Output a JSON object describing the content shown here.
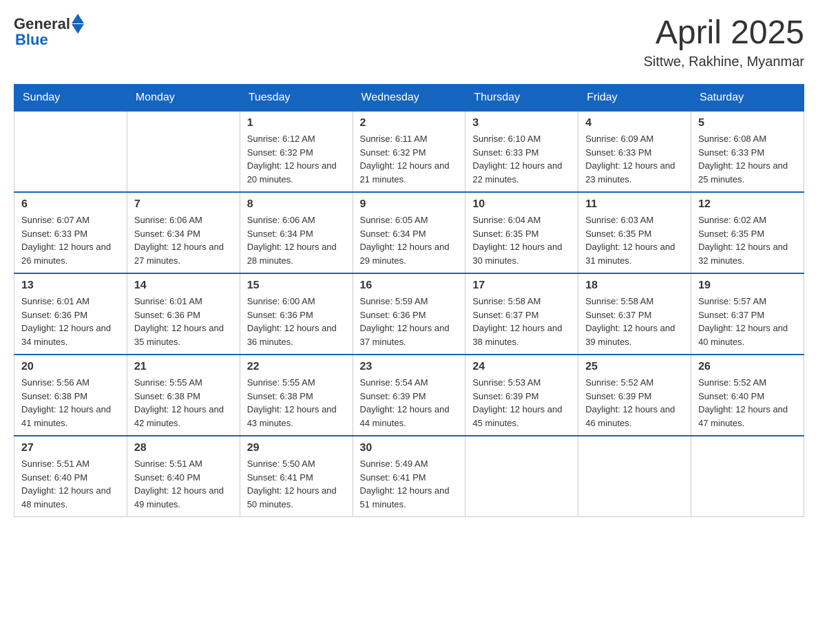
{
  "header": {
    "logo_general": "General",
    "logo_blue": "Blue",
    "month_year": "April 2025",
    "location": "Sittwe, Rakhine, Myanmar"
  },
  "days_of_week": [
    "Sunday",
    "Monday",
    "Tuesday",
    "Wednesday",
    "Thursday",
    "Friday",
    "Saturday"
  ],
  "weeks": [
    [
      {
        "day": "",
        "sunrise": "",
        "sunset": "",
        "daylight": ""
      },
      {
        "day": "",
        "sunrise": "",
        "sunset": "",
        "daylight": ""
      },
      {
        "day": "1",
        "sunrise": "Sunrise: 6:12 AM",
        "sunset": "Sunset: 6:32 PM",
        "daylight": "Daylight: 12 hours and 20 minutes."
      },
      {
        "day": "2",
        "sunrise": "Sunrise: 6:11 AM",
        "sunset": "Sunset: 6:32 PM",
        "daylight": "Daylight: 12 hours and 21 minutes."
      },
      {
        "day": "3",
        "sunrise": "Sunrise: 6:10 AM",
        "sunset": "Sunset: 6:33 PM",
        "daylight": "Daylight: 12 hours and 22 minutes."
      },
      {
        "day": "4",
        "sunrise": "Sunrise: 6:09 AM",
        "sunset": "Sunset: 6:33 PM",
        "daylight": "Daylight: 12 hours and 23 minutes."
      },
      {
        "day": "5",
        "sunrise": "Sunrise: 6:08 AM",
        "sunset": "Sunset: 6:33 PM",
        "daylight": "Daylight: 12 hours and 25 minutes."
      }
    ],
    [
      {
        "day": "6",
        "sunrise": "Sunrise: 6:07 AM",
        "sunset": "Sunset: 6:33 PM",
        "daylight": "Daylight: 12 hours and 26 minutes."
      },
      {
        "day": "7",
        "sunrise": "Sunrise: 6:06 AM",
        "sunset": "Sunset: 6:34 PM",
        "daylight": "Daylight: 12 hours and 27 minutes."
      },
      {
        "day": "8",
        "sunrise": "Sunrise: 6:06 AM",
        "sunset": "Sunset: 6:34 PM",
        "daylight": "Daylight: 12 hours and 28 minutes."
      },
      {
        "day": "9",
        "sunrise": "Sunrise: 6:05 AM",
        "sunset": "Sunset: 6:34 PM",
        "daylight": "Daylight: 12 hours and 29 minutes."
      },
      {
        "day": "10",
        "sunrise": "Sunrise: 6:04 AM",
        "sunset": "Sunset: 6:35 PM",
        "daylight": "Daylight: 12 hours and 30 minutes."
      },
      {
        "day": "11",
        "sunrise": "Sunrise: 6:03 AM",
        "sunset": "Sunset: 6:35 PM",
        "daylight": "Daylight: 12 hours and 31 minutes."
      },
      {
        "day": "12",
        "sunrise": "Sunrise: 6:02 AM",
        "sunset": "Sunset: 6:35 PM",
        "daylight": "Daylight: 12 hours and 32 minutes."
      }
    ],
    [
      {
        "day": "13",
        "sunrise": "Sunrise: 6:01 AM",
        "sunset": "Sunset: 6:36 PM",
        "daylight": "Daylight: 12 hours and 34 minutes."
      },
      {
        "day": "14",
        "sunrise": "Sunrise: 6:01 AM",
        "sunset": "Sunset: 6:36 PM",
        "daylight": "Daylight: 12 hours and 35 minutes."
      },
      {
        "day": "15",
        "sunrise": "Sunrise: 6:00 AM",
        "sunset": "Sunset: 6:36 PM",
        "daylight": "Daylight: 12 hours and 36 minutes."
      },
      {
        "day": "16",
        "sunrise": "Sunrise: 5:59 AM",
        "sunset": "Sunset: 6:36 PM",
        "daylight": "Daylight: 12 hours and 37 minutes."
      },
      {
        "day": "17",
        "sunrise": "Sunrise: 5:58 AM",
        "sunset": "Sunset: 6:37 PM",
        "daylight": "Daylight: 12 hours and 38 minutes."
      },
      {
        "day": "18",
        "sunrise": "Sunrise: 5:58 AM",
        "sunset": "Sunset: 6:37 PM",
        "daylight": "Daylight: 12 hours and 39 minutes."
      },
      {
        "day": "19",
        "sunrise": "Sunrise: 5:57 AM",
        "sunset": "Sunset: 6:37 PM",
        "daylight": "Daylight: 12 hours and 40 minutes."
      }
    ],
    [
      {
        "day": "20",
        "sunrise": "Sunrise: 5:56 AM",
        "sunset": "Sunset: 6:38 PM",
        "daylight": "Daylight: 12 hours and 41 minutes."
      },
      {
        "day": "21",
        "sunrise": "Sunrise: 5:55 AM",
        "sunset": "Sunset: 6:38 PM",
        "daylight": "Daylight: 12 hours and 42 minutes."
      },
      {
        "day": "22",
        "sunrise": "Sunrise: 5:55 AM",
        "sunset": "Sunset: 6:38 PM",
        "daylight": "Daylight: 12 hours and 43 minutes."
      },
      {
        "day": "23",
        "sunrise": "Sunrise: 5:54 AM",
        "sunset": "Sunset: 6:39 PM",
        "daylight": "Daylight: 12 hours and 44 minutes."
      },
      {
        "day": "24",
        "sunrise": "Sunrise: 5:53 AM",
        "sunset": "Sunset: 6:39 PM",
        "daylight": "Daylight: 12 hours and 45 minutes."
      },
      {
        "day": "25",
        "sunrise": "Sunrise: 5:52 AM",
        "sunset": "Sunset: 6:39 PM",
        "daylight": "Daylight: 12 hours and 46 minutes."
      },
      {
        "day": "26",
        "sunrise": "Sunrise: 5:52 AM",
        "sunset": "Sunset: 6:40 PM",
        "daylight": "Daylight: 12 hours and 47 minutes."
      }
    ],
    [
      {
        "day": "27",
        "sunrise": "Sunrise: 5:51 AM",
        "sunset": "Sunset: 6:40 PM",
        "daylight": "Daylight: 12 hours and 48 minutes."
      },
      {
        "day": "28",
        "sunrise": "Sunrise: 5:51 AM",
        "sunset": "Sunset: 6:40 PM",
        "daylight": "Daylight: 12 hours and 49 minutes."
      },
      {
        "day": "29",
        "sunrise": "Sunrise: 5:50 AM",
        "sunset": "Sunset: 6:41 PM",
        "daylight": "Daylight: 12 hours and 50 minutes."
      },
      {
        "day": "30",
        "sunrise": "Sunrise: 5:49 AM",
        "sunset": "Sunset: 6:41 PM",
        "daylight": "Daylight: 12 hours and 51 minutes."
      },
      {
        "day": "",
        "sunrise": "",
        "sunset": "",
        "daylight": ""
      },
      {
        "day": "",
        "sunrise": "",
        "sunset": "",
        "daylight": ""
      },
      {
        "day": "",
        "sunrise": "",
        "sunset": "",
        "daylight": ""
      }
    ]
  ]
}
